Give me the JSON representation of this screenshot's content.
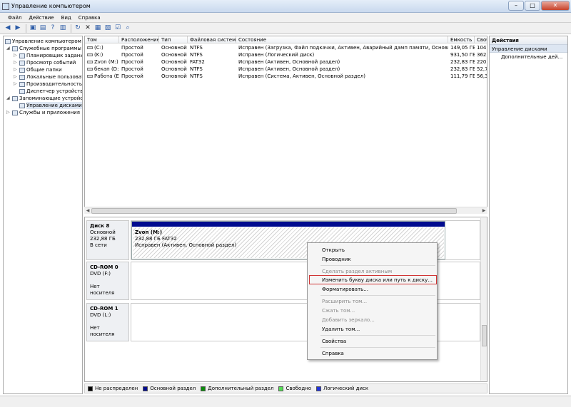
{
  "window": {
    "title": "Управление компьютером"
  },
  "menu": [
    "Файл",
    "Действие",
    "Вид",
    "Справка"
  ],
  "tree": {
    "items": [
      {
        "label": "Управление компьютером (л",
        "indent": 0,
        "expander": ""
      },
      {
        "label": "Служебные программы",
        "indent": 1,
        "expander": "◢"
      },
      {
        "label": "Планировщик заданий",
        "indent": 2,
        "expander": "▷"
      },
      {
        "label": "Просмотр событий",
        "indent": 2,
        "expander": "▷"
      },
      {
        "label": "Общие папки",
        "indent": 2,
        "expander": "▷"
      },
      {
        "label": "Локальные пользовател",
        "indent": 2,
        "expander": "▷"
      },
      {
        "label": "Производительность",
        "indent": 2,
        "expander": "▷"
      },
      {
        "label": "Диспетчер устройств",
        "indent": 2,
        "expander": ""
      },
      {
        "label": "Запоминающие устройст",
        "indent": 1,
        "expander": "◢"
      },
      {
        "label": "Управление дисками",
        "indent": 2,
        "expander": ""
      },
      {
        "label": "Службы и приложения",
        "indent": 1,
        "expander": "▷"
      }
    ]
  },
  "volumes": {
    "columns": [
      "Том",
      "Расположение",
      "Тип",
      "Файловая система",
      "Состояние",
      "Емкость",
      "Своб"
    ],
    "rows": [
      [
        "(C:)",
        "Простой",
        "Основной",
        "NTFS",
        "Исправен (Загрузка, Файл подкачки, Активен, Аварийный дамп памяти, Основной раздел)",
        "149,05 ГБ",
        "104,8"
      ],
      [
        "(K:)",
        "Простой",
        "Основной",
        "NTFS",
        "Исправен (Логический диск)",
        "931,50 ГБ",
        "362,2"
      ],
      [
        "Zvon (M:)",
        "Простой",
        "Основной",
        "FAT32",
        "Исправен (Активен, Основной раздел)",
        "232,83 ГБ",
        "220,7"
      ],
      [
        "бекап (D:)",
        "Простой",
        "Основной",
        "NTFS",
        "Исправен (Активен, Основной раздел)",
        "232,83 ГБ",
        "52,72"
      ],
      [
        "Работа (E:)",
        "Простой",
        "Основной",
        "NTFS",
        "Исправен (Система, Активен, Основной раздел)",
        "111,79 ГБ",
        "56,33"
      ]
    ]
  },
  "disks": {
    "disk8": {
      "name": "Диск 8",
      "type": "Основной",
      "size": "232,88 ГБ",
      "status": "В сети",
      "partition": {
        "name": "Zvon  (M:)",
        "info": "232,88 ГБ FAT32",
        "status": "Исправен (Активен, Основной раздел)"
      }
    },
    "cdrom0": {
      "name": "CD-ROM 0",
      "type": "DVD (F:)",
      "status": "Нет носителя"
    },
    "cdrom1": {
      "name": "CD-ROM 1",
      "type": "DVD (L:)",
      "status": "Нет носителя"
    }
  },
  "legend": [
    {
      "label": "Не распределен",
      "color": "#000000"
    },
    {
      "label": "Основной раздел",
      "color": "#000b8f"
    },
    {
      "label": "Дополнительный раздел",
      "color": "#0b8a0b"
    },
    {
      "label": "Свободно",
      "color": "#55dd55"
    },
    {
      "label": "Логический диск",
      "color": "#2233dd"
    }
  ],
  "actions": {
    "header": "Действия",
    "section": "Управление дисками",
    "more": "Дополнительные дей..."
  },
  "context_menu": {
    "items": [
      {
        "label": "Открыть",
        "disabled": false
      },
      {
        "label": "Проводник",
        "disabled": false
      },
      {
        "label": "Сделать раздел активным",
        "disabled": true
      },
      {
        "label": "Изменить букву диска или путь к диску...",
        "disabled": false,
        "highlighted": true
      },
      {
        "label": "Форматировать...",
        "disabled": false
      },
      {
        "label": "Расширить том...",
        "disabled": true
      },
      {
        "label": "Сжать том...",
        "disabled": true
      },
      {
        "label": "Добавить зеркало...",
        "disabled": true
      },
      {
        "label": "Удалить том...",
        "disabled": false
      },
      {
        "label": "Свойства",
        "disabled": false
      },
      {
        "label": "Справка",
        "disabled": false
      }
    ]
  }
}
